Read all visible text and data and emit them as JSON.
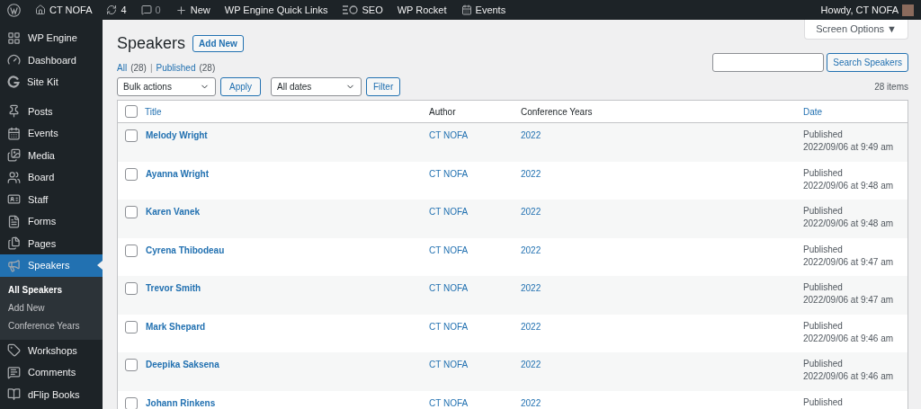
{
  "admin_bar": {
    "site": "CT NOFA",
    "updates": "4",
    "comments": "0",
    "new": "New",
    "links": [
      "WP Engine Quick Links",
      "SEO",
      "WP Rocket",
      "Events"
    ],
    "greeting": "Howdy, CT NOFA"
  },
  "sidebar": {
    "groups": [
      [
        {
          "label": "WP Engine",
          "selected": false
        },
        {
          "label": "Dashboard",
          "selected": false
        },
        {
          "label": "Site Kit",
          "selected": false
        }
      ],
      [
        {
          "label": "Posts",
          "selected": false
        },
        {
          "label": "Events",
          "selected": false
        },
        {
          "label": "Media",
          "selected": false
        },
        {
          "label": "Board",
          "selected": false
        },
        {
          "label": "Staff",
          "selected": false
        },
        {
          "label": "Forms",
          "selected": false
        },
        {
          "label": "Pages",
          "selected": false
        },
        {
          "label": "Speakers",
          "selected": true,
          "children": [
            {
              "label": "All Speakers",
              "selected": true
            },
            {
              "label": "Add New",
              "selected": false
            },
            {
              "label": "Conference Years",
              "selected": false
            }
          ]
        },
        {
          "label": "Workshops",
          "selected": false
        },
        {
          "label": "Comments",
          "selected": false
        },
        {
          "label": "dFlip Books",
          "selected": false
        }
      ]
    ]
  },
  "screen_options": "Screen Options ▼",
  "page_title": "Speakers",
  "add_new": "Add New",
  "filters": [
    {
      "label": "All",
      "count": "(28)",
      "selected": false
    },
    {
      "label": "Published",
      "count": "(28)",
      "selected": false
    }
  ],
  "filter_separator": "|",
  "search": {
    "button": "Search Speakers"
  },
  "select_all_checked": false,
  "bulk_actions": "Bulk actions",
  "apply": "Apply",
  "dates": "All dates",
  "filter": "Filter",
  "items_count": "28 items",
  "table": {
    "columns": [
      "Title",
      "Author",
      "Conference Years",
      "Date"
    ],
    "rows": [
      {
        "title": "Melody Wright",
        "author": "CT NOFA",
        "year": "2022",
        "status": "Published",
        "time": "2022/09/06 at 9:49 am",
        "checked": false
      },
      {
        "title": "Ayanna Wright",
        "author": "CT NOFA",
        "year": "2022",
        "status": "Published",
        "time": "2022/09/06 at 9:48 am",
        "checked": false
      },
      {
        "title": "Karen Vanek",
        "author": "CT NOFA",
        "year": "2022",
        "status": "Published",
        "time": "2022/09/06 at 9:48 am",
        "checked": false
      },
      {
        "title": "Cyrena Thibodeau",
        "author": "CT NOFA",
        "year": "2022",
        "status": "Published",
        "time": "2022/09/06 at 9:47 am",
        "checked": false
      },
      {
        "title": "Trevor Smith",
        "author": "CT NOFA",
        "year": "2022",
        "status": "Published",
        "time": "2022/09/06 at 9:47 am",
        "checked": false
      },
      {
        "title": "Mark Shepard",
        "author": "CT NOFA",
        "year": "2022",
        "status": "Published",
        "time": "2022/09/06 at 9:46 am",
        "checked": false
      },
      {
        "title": "Deepika Saksena",
        "author": "CT NOFA",
        "year": "2022",
        "status": "Published",
        "time": "2022/09/06 at 9:46 am",
        "checked": false
      },
      {
        "title": "Johann Rinkens",
        "author": "CT NOFA",
        "year": "2022",
        "status": "Published",
        "checked": false
      }
    ]
  }
}
